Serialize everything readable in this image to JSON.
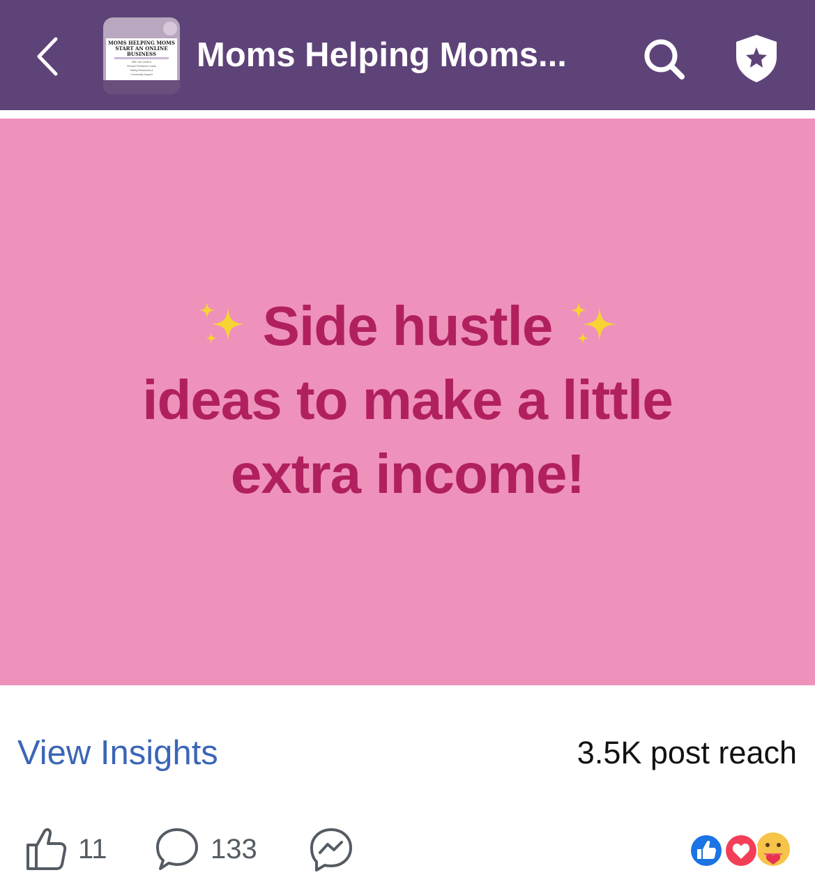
{
  "header": {
    "back_icon": "chevron-left-icon",
    "group_name": "Moms Helping Moms...",
    "thumbnail": {
      "line1": "MOMS HELPING MOMS",
      "line2": "START AN ONLINE",
      "line3": "BUSINESS",
      "small_lines": [
        "With Job Leads &",
        "Remote Freelancer Leads",
        "Startup Resources &",
        "Community Support"
      ]
    },
    "search_icon": "search-icon",
    "shield_icon": "admin-shield-star-icon"
  },
  "post": {
    "background_color": "#ee92bb",
    "text_color": "#b1205e",
    "line1": "Side hustle",
    "line2": "ideas to make a little",
    "line3": "extra income!",
    "decoration_icon": "sparkles-icon"
  },
  "insights": {
    "link_label": "View Insights",
    "reach_text": "3.5K post reach"
  },
  "actions": {
    "like_count": "11",
    "comment_count": "133",
    "like_icon": "thumbs-up-icon",
    "comment_icon": "comment-bubble-icon",
    "messenger_icon": "messenger-icon"
  },
  "reactions": [
    "like-reaction-icon",
    "love-reaction-icon",
    "care-reaction-icon"
  ]
}
